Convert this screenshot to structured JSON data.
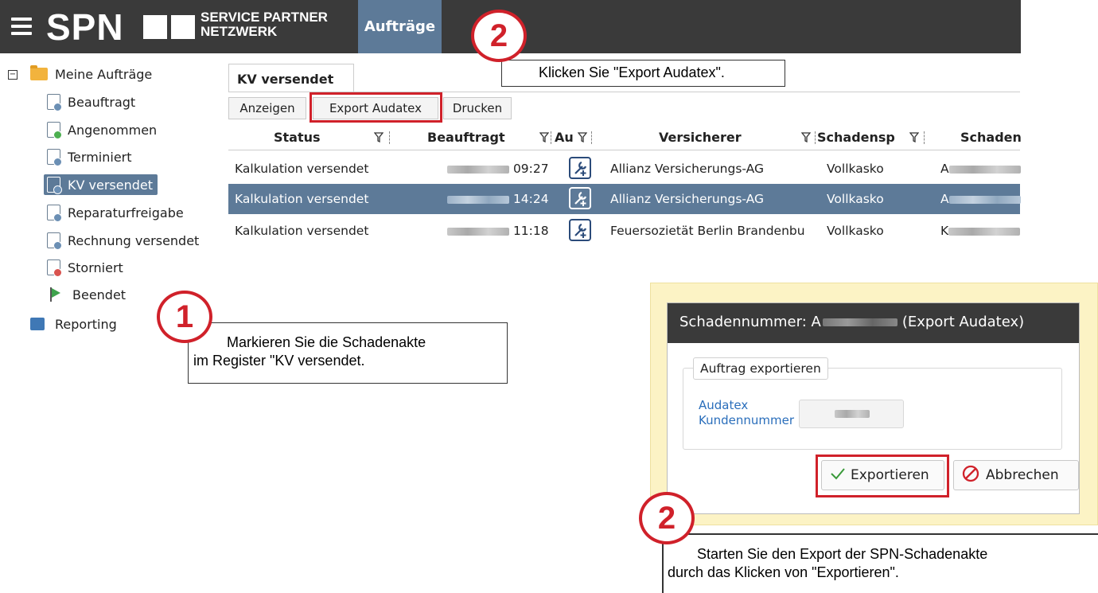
{
  "header": {
    "brand": "SPN",
    "brand_sub_line1": "SERVICE PARTNER",
    "brand_sub_line2": "NETZWERK",
    "active_tab": "Aufträge"
  },
  "sidebar": {
    "root": "Meine Aufträge",
    "items": [
      "Beauftragt",
      "Angenommen",
      "Terminiert",
      "KV versendet",
      "Reparaturfreigabe",
      "Rechnung versendet",
      "Storniert",
      "Beendet"
    ],
    "reporting": "Reporting",
    "selected": "KV versendet"
  },
  "main": {
    "tab": "KV versendet",
    "toolbar": [
      "Anzeigen",
      "Export Audatex",
      "Drucken"
    ],
    "columns": [
      "Status",
      "Beauftragt",
      "Au",
      "Versicherer",
      "Schadensp",
      "Schaden"
    ],
    "rows": [
      {
        "status": "Kalkulation versendet",
        "time": "09:27",
        "insurer": "Allianz Versicherungs-AG",
        "type": "Vollkasko",
        "claim_prefix": "A",
        "selected": false
      },
      {
        "status": "Kalkulation versendet",
        "time": "14:24",
        "insurer": "Allianz Versicherungs-AG",
        "type": "Vollkasko",
        "claim_prefix": "A",
        "selected": true
      },
      {
        "status": "Kalkulation versendet",
        "time": "11:18",
        "insurer": "Feuersozietät Berlin Brandenbu",
        "type": "Vollkasko",
        "claim_prefix": "K",
        "selected": false
      }
    ]
  },
  "callouts": {
    "step1_number": "1",
    "step1_line1": "Markieren Sie die Schadenakte",
    "step1_line2": "im Register \"KV versendet.",
    "step2_number": "2",
    "step2_text": "Klicken Sie \"Export Audatex\".",
    "step3_number": "2",
    "step3_line1": "Starten Sie den Export der SPN-Schadenakte",
    "step3_line2": "durch das Klicken von \"Exportieren\"."
  },
  "dialog": {
    "title_prefix": "Schadennummer: A",
    "title_suffix": "(Export Audatex)",
    "legend": "Auftrag exportieren",
    "field_label_line1": "Audatex",
    "field_label_line2": "Kundennummer",
    "export_button": "Exportieren",
    "cancel_button": "Abbrechen"
  },
  "colors": {
    "topbar": "#3a3a3a",
    "accent": "#5d7a98",
    "highlight": "#d0212a",
    "dialog_backdrop": "#fcf3c5"
  }
}
